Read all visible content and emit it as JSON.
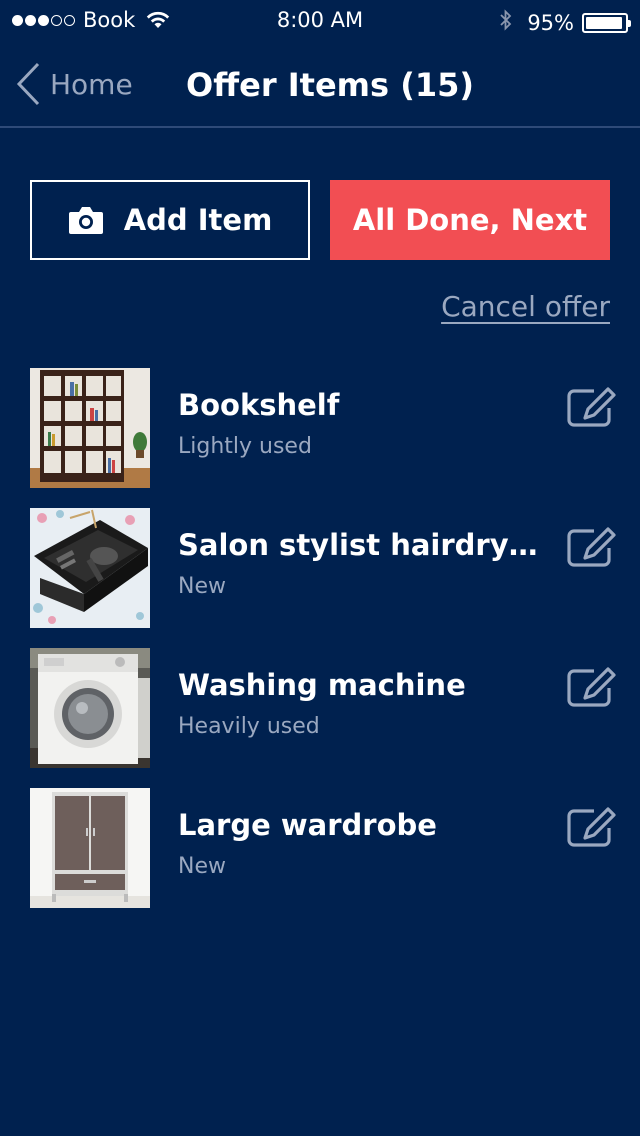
{
  "status_bar": {
    "carrier": "Book",
    "time": "8:00 AM",
    "battery": "95%",
    "signal_icon": "signal-dots-icon",
    "wifi_icon": "wifi-icon",
    "bluetooth_icon": "bluetooth-icon"
  },
  "nav": {
    "back_label": "Home",
    "title": "Offer Items (15)"
  },
  "actions": {
    "add_item_label": "Add Item",
    "done_label": "All Done, Next",
    "cancel_label": "Cancel offer",
    "add_icon": "camera-icon"
  },
  "colors": {
    "background": "#00214f",
    "accent": "#f24e53",
    "muted_text": "#9aa8c0"
  },
  "items": [
    {
      "title": "Bookshelf",
      "condition": "Lightly used",
      "thumb": "bookshelf-image"
    },
    {
      "title": "Salon stylist hairdryer set",
      "condition": "New",
      "thumb": "hairdryer-image"
    },
    {
      "title": "Washing machine",
      "condition": "Heavily used",
      "thumb": "washing-machine-image"
    },
    {
      "title": "Large wardrobe",
      "condition": "New",
      "thumb": "wardrobe-image"
    }
  ]
}
